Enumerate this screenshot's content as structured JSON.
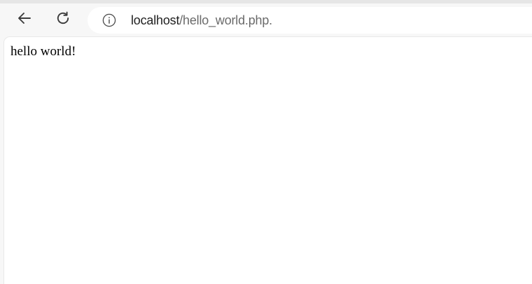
{
  "toolbar": {
    "back_icon": "arrow-left-icon",
    "reload_icon": "reload-icon",
    "site_info_icon": "info-icon",
    "url": {
      "host": "localhost",
      "path": "/hello_world.php."
    }
  },
  "page": {
    "body_text": "hello world!"
  },
  "colors": {
    "chrome_background": "#f7f7f7",
    "address_bar": "#ffffff",
    "url_host": "#1f1f1f",
    "url_path": "#6b6b6b"
  }
}
